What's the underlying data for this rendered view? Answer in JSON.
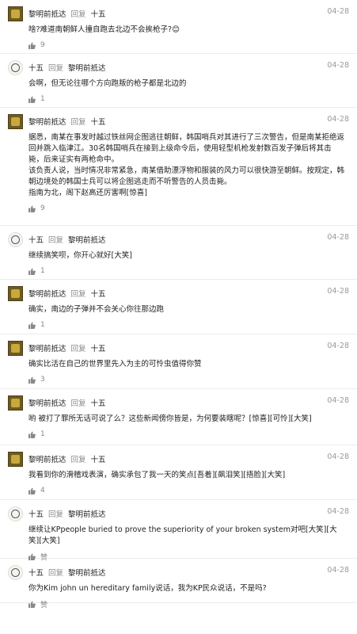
{
  "reply_label": "回复",
  "comments": [
    {
      "author": "黎明前抵达",
      "avatar": "a",
      "target": "十五",
      "date": "04-28",
      "text": "啥?难道南朝鲜人撞自跑去北边不会挨枪子?😊",
      "likes": "9"
    },
    {
      "author": "十五",
      "avatar": "b",
      "target": "黎明前抵达",
      "date": "04-28",
      "text": "会啊，但无论往哪个方向跑叛的枪子都是北边的",
      "likes": "1"
    },
    {
      "author": "黎明前抵达",
      "avatar": "a",
      "target": "十五",
      "date": "04-28",
      "text": "据悉，南某在事发时越过铁丝网企图逃往朝鲜，韩国哨兵对其进行了三次警告，但是南某拒绝返回并跳入临津江。30名韩国哨兵在接到上级命令后，使用轻型机枪发射数百发子弹后将其击毙，后来证实有两枪命中。\n该负责人说，当时情况非常紧急，南某借助漂浮物和服装的风力可以很快游至朝鲜。按规定，韩朝边境处的韩国士兵可以将企图逃走而不听警告的人员击毙。\n指南为北，阁下赵高还厉害啊[惊喜]",
      "likes": "9"
    },
    {
      "author": "十五",
      "avatar": "b",
      "target": "黎明前抵达",
      "date": "04-28",
      "text": "继续搞笑呗，你开心就好[大笑]",
      "likes": "1"
    },
    {
      "author": "黎明前抵达",
      "avatar": "a",
      "target": "十五",
      "date": "04-28",
      "text": "确实，南边的子弹并不会关心你往那边跑",
      "likes": "1"
    },
    {
      "author": "黎明前抵达",
      "avatar": "a",
      "target": "十五",
      "date": "04-28",
      "text": "确实比活在自己的世界里先入为主的可怜虫值得你赞",
      "likes": "3"
    },
    {
      "author": "黎明前抵达",
      "avatar": "a",
      "target": "十五",
      "date": "04-28",
      "text": "哟 被打了罪所无话可说了么？这些新闻傍你皆是，为何要装瞎呢？[惊喜][可怜][大笑]",
      "likes": "1"
    },
    {
      "author": "黎明前抵达",
      "avatar": "a",
      "target": "十五",
      "date": "04-28",
      "text": "我看到你的滑稽戏表演，确实承包了我一天的笑点[吾着][飙泪笑][捂脸][大笑]",
      "likes": "4"
    },
    {
      "author": "十五",
      "avatar": "b",
      "target": "黎明前抵达",
      "date": "04-28",
      "text": "继续让KPpeople buried to prove the superiority of your broken system对吧[大笑][大笑][大笑]",
      "likes": "赞"
    },
    {
      "author": "十五",
      "avatar": "b",
      "target": "黎明前抵达",
      "date": "04-28",
      "text": "你为Kim john un hereditary family说话，我为KP民众说话，不是吗?",
      "likes": "赞"
    }
  ]
}
